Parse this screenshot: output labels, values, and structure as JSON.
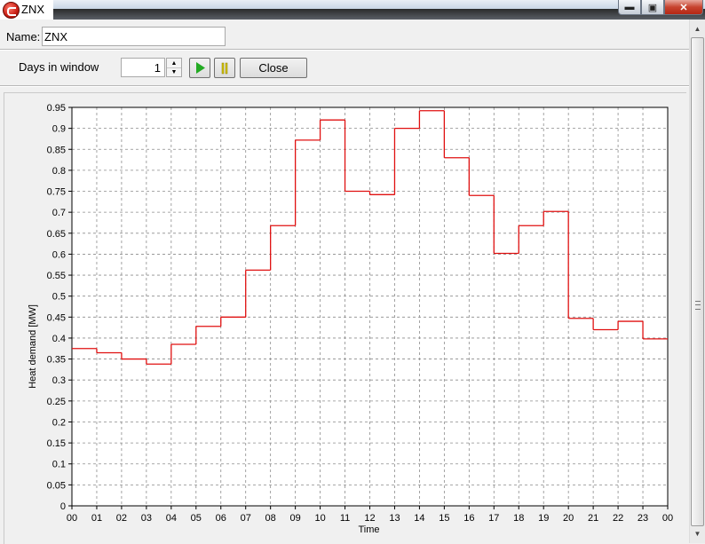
{
  "window": {
    "title": "ZNX",
    "controls": {
      "minimize": "▬",
      "maximize": "▣",
      "close": "✕"
    }
  },
  "form": {
    "name_label": "Name:",
    "name_value": "ZNX",
    "days_label": "Days in window",
    "days_value": "1",
    "close_label": "Close"
  },
  "colors": {
    "series": "#e01010",
    "play": "#22aa22",
    "pause": "#d4c400",
    "grid": "#8c8c8c"
  },
  "chart_data": {
    "type": "line",
    "step": true,
    "ylabel": "Heat demand [MW]",
    "xlabel": "Time",
    "ylim": [
      0,
      0.95
    ],
    "yticks": [
      "0",
      "0.05",
      "0.1",
      "0.15",
      "0.2",
      "0.25",
      "0.3",
      "0.35",
      "0.4",
      "0.45",
      "0.5",
      "0.55",
      "0.6",
      "0.65",
      "0.7",
      "0.75",
      "0.8",
      "0.85",
      "0.9",
      "0.95"
    ],
    "xticks": [
      "00",
      "01",
      "02",
      "03",
      "04",
      "05",
      "06",
      "07",
      "08",
      "09",
      "10",
      "11",
      "12",
      "13",
      "14",
      "15",
      "16",
      "17",
      "18",
      "19",
      "20",
      "21",
      "22",
      "23",
      "00"
    ],
    "grid": true,
    "values": [
      0.375,
      0.365,
      0.35,
      0.338,
      0.385,
      0.428,
      0.45,
      0.562,
      0.668,
      0.872,
      0.92,
      0.75,
      0.742,
      0.9,
      0.942,
      0.83,
      0.74,
      0.602,
      0.668,
      0.702,
      0.447,
      0.42,
      0.44,
      0.398
    ]
  }
}
